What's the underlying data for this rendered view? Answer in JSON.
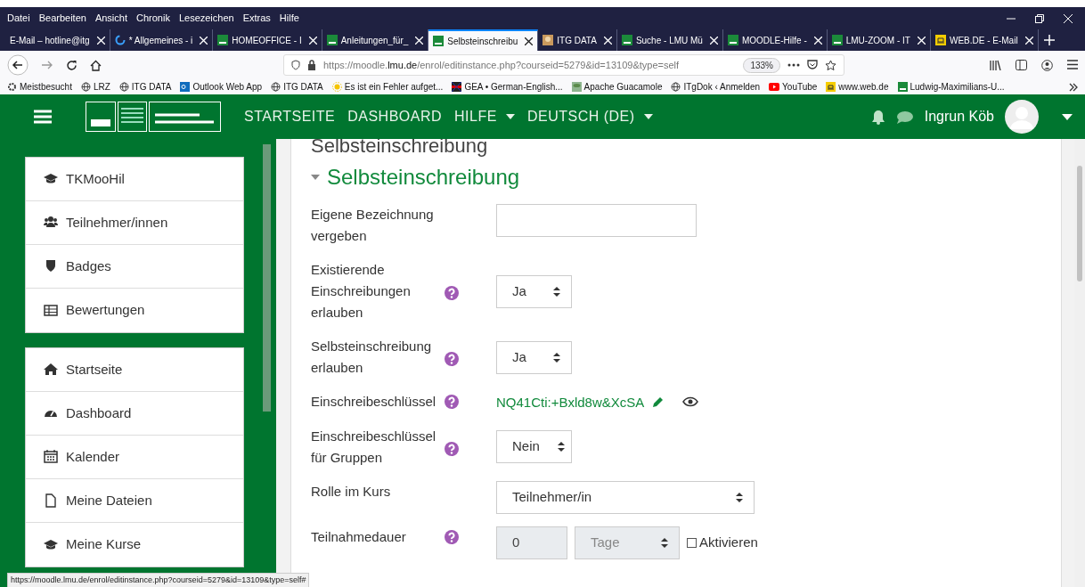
{
  "menu": [
    "Datei",
    "Bearbeiten",
    "Ansicht",
    "Chronik",
    "Lesezeichen",
    "Extras",
    "Hilfe"
  ],
  "tabs": [
    {
      "label": "E-Mail – hotline@itg",
      "kind": "plain",
      "selected": false
    },
    {
      "label": "* Allgemeines - i",
      "kind": "loading",
      "selected": false
    },
    {
      "label": "HOMEOFFICE - I",
      "kind": "lmu",
      "selected": false
    },
    {
      "label": "Anleitungen_für_",
      "kind": "lmu",
      "selected": false
    },
    {
      "label": "Selbsteinschreibu",
      "kind": "lmu",
      "selected": true
    },
    {
      "label": "ITG DATA",
      "kind": "photo",
      "selected": false
    },
    {
      "label": "Suche - LMU Mü",
      "kind": "lmu",
      "selected": false
    },
    {
      "label": "MOODLE-Hilfe -",
      "kind": "lmu",
      "selected": false
    },
    {
      "label": "LMU-ZOOM - IT",
      "kind": "lmu",
      "selected": false
    },
    {
      "label": "WEB.DE - E-Mail",
      "kind": "webde",
      "selected": false
    }
  ],
  "address": {
    "prefix": "https://moodle.",
    "host": "lmu.de",
    "path": "/enrol/editinstance.php?courseid=5279&id=13109&type=self",
    "zoom": "133%"
  },
  "bookmarks": [
    {
      "label": "Meistbesucht",
      "kind": "gear"
    },
    {
      "label": "LRZ",
      "kind": "globe"
    },
    {
      "label": "ITG DATA",
      "kind": "globe"
    },
    {
      "label": "Outlook Web App",
      "kind": "outlook"
    },
    {
      "label": "ITG DATA",
      "kind": "globe"
    },
    {
      "label": "Es ist ein Fehler aufget...",
      "kind": "sun"
    },
    {
      "label": "GEA • German-English...",
      "kind": "flag"
    },
    {
      "label": "Apache Guacamole",
      "kind": "guac"
    },
    {
      "label": "ITgDok ‹ Anmelden",
      "kind": "globe"
    },
    {
      "label": "YouTube",
      "kind": "youtube"
    },
    {
      "label": "www.web.de",
      "kind": "webde"
    },
    {
      "label": "Ludwig-Maximilians-U...",
      "kind": "lmu"
    }
  ],
  "header": {
    "nav": [
      {
        "label": "STARTSEITE",
        "dropdown": false
      },
      {
        "label": "DASHBOARD",
        "dropdown": false
      },
      {
        "label": "HILFE",
        "dropdown": true
      },
      {
        "label": "DEUTSCH (DE)",
        "dropdown": true
      }
    ],
    "user": "Ingrun Köb"
  },
  "sidebar": [
    [
      {
        "label": "TKMooHil",
        "kind": "cap"
      },
      {
        "label": "Teilnehmer/innen",
        "kind": "users"
      },
      {
        "label": "Badges",
        "kind": "shield"
      },
      {
        "label": "Bewertungen",
        "kind": "table"
      }
    ],
    [
      {
        "label": "Startseite",
        "kind": "home"
      },
      {
        "label": "Dashboard",
        "kind": "gauge"
      },
      {
        "label": "Kalender",
        "kind": "calendar"
      },
      {
        "label": "Meine Dateien",
        "kind": "file"
      },
      {
        "label": "Meine Kurse",
        "kind": "cap"
      }
    ]
  ],
  "page_title": "Selbsteinschreibung",
  "section": {
    "title": "Selbsteinschreibung",
    "expanded": true
  },
  "fields": [
    {
      "label": "Eigene Bezeichnung vergeben",
      "help": false,
      "kind": "text"
    },
    {
      "label": "Existierende Einschreibungen erlauben",
      "help": true,
      "kind": "select",
      "value": "Ja"
    },
    {
      "label": "Selbsteinschreibung erlauben",
      "help": true,
      "kind": "select",
      "value": "Ja"
    },
    {
      "label": "Einschreibeschlüssel",
      "help": true,
      "kind": "key",
      "value": "NQ41Cti:+Bxld8w&XcSA"
    },
    {
      "label": "Einschreibeschlüssel für Gruppen",
      "help": true,
      "kind": "select",
      "value": "Nein"
    },
    {
      "label": "Rolle im Kurs",
      "help": false,
      "kind": "select_wide",
      "value": "Teilnehmer/in"
    },
    {
      "label": "Teilnahmedauer",
      "help": true,
      "kind": "duration",
      "value": "0",
      "unit": "Tage",
      "disabled": true,
      "checkbox": {
        "label": "Aktivieren",
        "checked": false
      }
    }
  ],
  "status_url": "https://moodle.lmu.de/enrol/editinstance.php?courseid=5279&id=13109&type=self#"
}
